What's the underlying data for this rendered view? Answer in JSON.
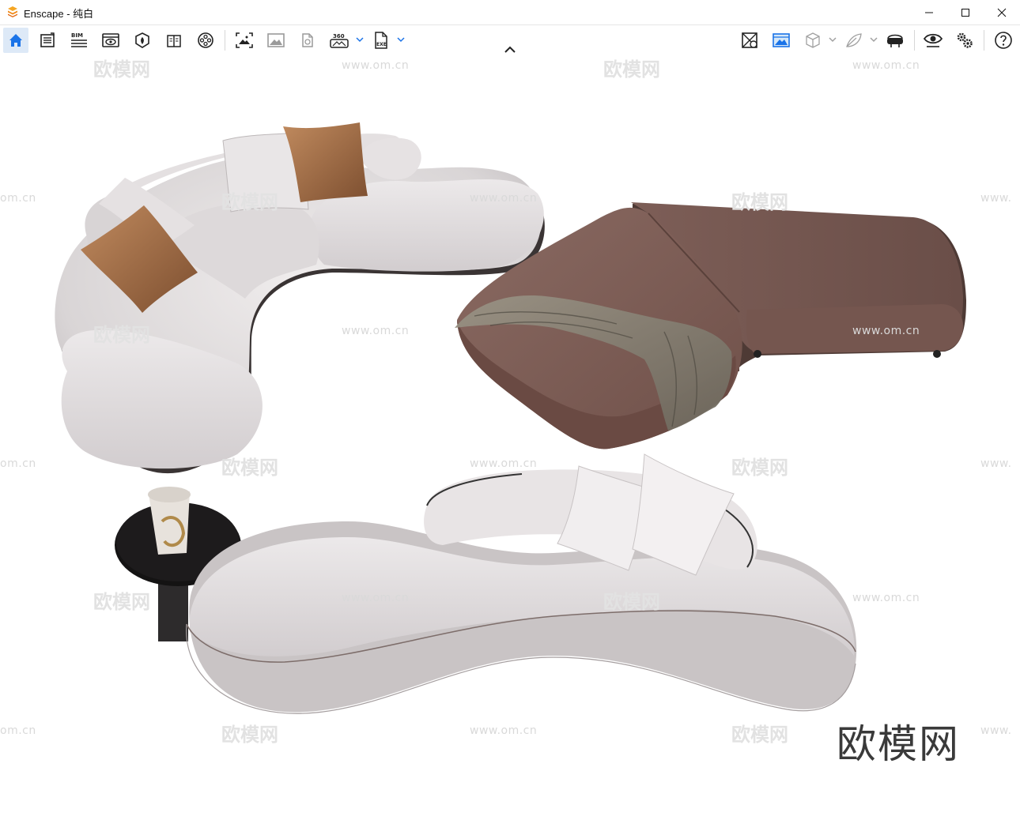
{
  "window": {
    "app_name": "Enscape",
    "title": "Enscape - 纯白",
    "accent_color": "#f5a623"
  },
  "toolbar": {
    "left_icons": [
      "home-icon",
      "batch-render-icon",
      "bim-icon",
      "views-icon",
      "asset-library-icon",
      "book-icon",
      "video-editor-icon",
      "screenshot-icon",
      "image-icon",
      "panorama-icon",
      "export-360-icon",
      "export-exe-icon"
    ],
    "bim_label": "BIM",
    "pano_label": "360",
    "exe_label": "EXE",
    "right_icons": [
      "sync-views-icon",
      "live-update-icon",
      "cube-icon",
      "feather-icon",
      "vr-headset-icon",
      "visual-settings-eye-icon",
      "settings-gears-icon",
      "help-icon"
    ],
    "active_color": "#1a73e8"
  },
  "watermarks": {
    "url": "www.om.cn",
    "url_partial": "om.cn",
    "url_cut": "www.",
    "brand": "欧模网"
  },
  "logo_text": "欧模网",
  "scene": {
    "objects": [
      "curved-sectional-sofa",
      "leather-ottoman-with-throw",
      "kidney-sofa-with-side-table"
    ]
  }
}
